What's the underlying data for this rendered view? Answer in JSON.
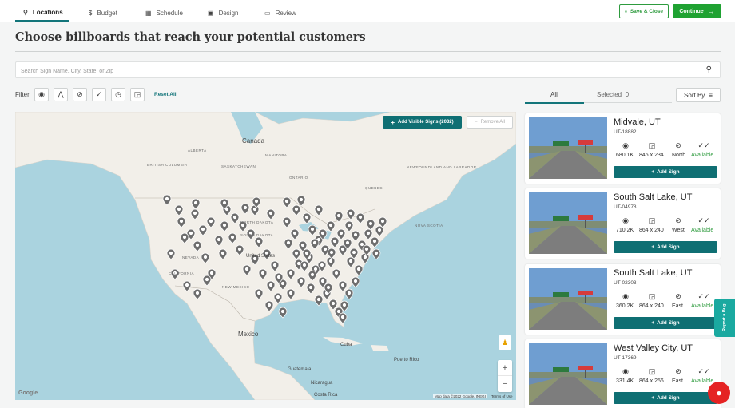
{
  "nav": {
    "tabs": [
      {
        "label": "Locations",
        "icon": "map-pin-icon",
        "active": true
      },
      {
        "label": "Budget",
        "icon": "dollar-icon",
        "active": false
      },
      {
        "label": "Schedule",
        "icon": "calendar-icon",
        "active": false
      },
      {
        "label": "Design",
        "icon": "image-icon",
        "active": false
      },
      {
        "label": "Review",
        "icon": "monitor-icon",
        "active": false
      }
    ],
    "save_close": "Save & Close",
    "continue": "Continue"
  },
  "page_title": "Choose billboards that reach your potential customers",
  "search": {
    "placeholder": "Search Sign Name, City, State, or Zip",
    "value": ""
  },
  "filter": {
    "label": "Filter",
    "buttons": [
      "eye-icon",
      "road-icon",
      "compass-icon",
      "check-icon",
      "timer-icon",
      "size-icon"
    ],
    "reset": "Reset All"
  },
  "map": {
    "add_visible": "Add Visible Signs (2032)",
    "remove_all": "Remove All",
    "labels": {
      "canada": "Canada",
      "alberta": "ALBERTA",
      "british_columbia": "BRITISH COLUMBIA",
      "saskatchewan": "SASKATCHEWAN",
      "manitoba": "MANITOBA",
      "ontario": "ONTARIO",
      "quebec": "QUEBEC",
      "newfoundland": "NEWFOUNDLAND AND LABRADOR",
      "nova_scotia": "NOVA SCOTIA",
      "north_dakota": "NORTH DAKOTA",
      "south_dakota": "SOUTH DAKOTA",
      "nevada": "NEVADA",
      "california": "CALIFORNIA",
      "new_mexico": "NEW MEXICO",
      "united_states": "United States",
      "mexico": "Mexico",
      "cuba": "Cuba",
      "puerto_rico": "Puerto Rico",
      "guatemala": "Guatemala",
      "nicaragua": "Nicaragua",
      "costa_rica": "Costa Rica"
    },
    "credit": "Map data ©2022 Google, INEGI",
    "terms": "Terms of Use",
    "google": "Google"
  },
  "results": {
    "tab_all": "All",
    "tab_selected": "Selected",
    "selected_count": "0",
    "sort_by": "Sort By"
  },
  "cards": [
    {
      "city": "Midvale, UT",
      "code": "UT-18882",
      "impressions": "680.1K",
      "size": "846 x 234",
      "facing": "North",
      "status": "Available",
      "add": "Add Sign"
    },
    {
      "city": "South Salt Lake, UT",
      "code": "UT-04978",
      "impressions": "710.2K",
      "size": "864 x 240",
      "facing": "West",
      "status": "Available",
      "add": "Add Sign"
    },
    {
      "city": "South Salt Lake, UT",
      "code": "UT-02303",
      "impressions": "360.2K",
      "size": "864 x 240",
      "facing": "East",
      "status": "Available",
      "add": "Add Sign"
    },
    {
      "city": "West Valley City, UT",
      "code": "UT-17369",
      "impressions": "331.4K",
      "size": "864 x 256",
      "facing": "East",
      "status": "Available",
      "add": "Add Sign"
    }
  ],
  "report_bug": "Report a Bug",
  "colors": {
    "teal": "#0f6f73",
    "green": "#1fa232",
    "available": "#2e9b3e",
    "chat": "#e52323"
  }
}
